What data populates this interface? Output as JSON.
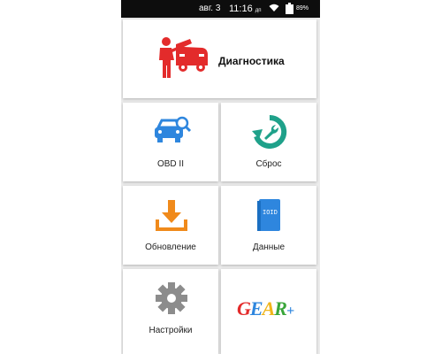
{
  "status_bar": {
    "date": "авг. 3",
    "time": "11:16",
    "time_suffix": "дп",
    "battery": "89%"
  },
  "menu": {
    "diagnostics_label": "Диагностика",
    "obd_label": "OBD II",
    "reset_label": "Сброс",
    "update_label": "Обновление",
    "data_label": "Данные",
    "data_book_text": "IOID",
    "settings_label": "Настройки",
    "gear_logo": {
      "g": "G",
      "e": "E",
      "a": "A",
      "r": "R",
      "plus": "+"
    }
  },
  "colors": {
    "red": "#e32b2b",
    "blue": "#2e86de",
    "teal": "#1fa18a",
    "orange": "#f08a1b",
    "gray": "#8c8c8c"
  },
  "icons": [
    "mechanic-car-icon",
    "car-search-icon",
    "reset-wrench-icon",
    "download-icon",
    "data-book-icon",
    "gear-icon"
  ]
}
